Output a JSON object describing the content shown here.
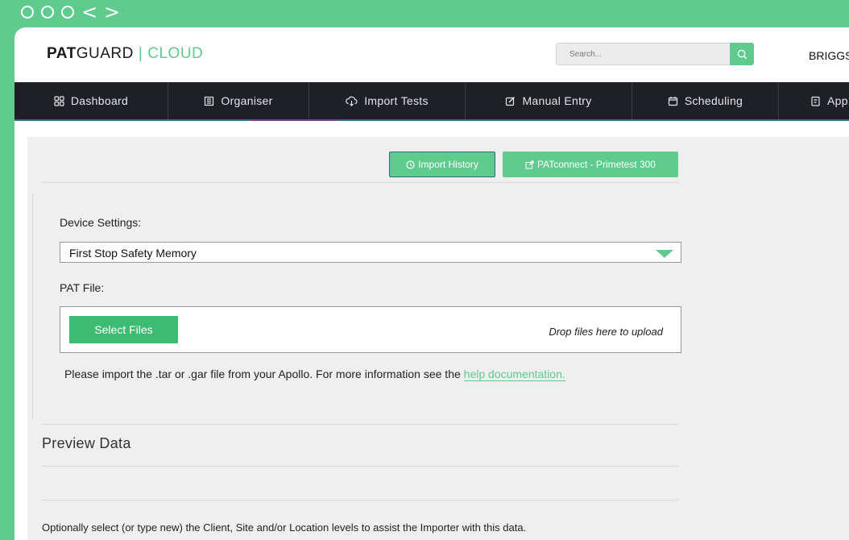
{
  "browser": {
    "back_arrow": "<",
    "forward_arrow": ">"
  },
  "header": {
    "logo_bold": "PAT",
    "logo_regular": "GUARD",
    "logo_separator": "|",
    "logo_cloud": "CLOUD",
    "search_placeholder": "Search...",
    "user_name": "BRIGGS"
  },
  "nav": {
    "items": [
      {
        "label": "Dashboard",
        "icon": "grid-icon"
      },
      {
        "label": "Organiser",
        "icon": "building-icon"
      },
      {
        "label": "Import Tests",
        "icon": "cloud-download-icon"
      },
      {
        "label": "Manual Entry",
        "icon": "edit-icon"
      },
      {
        "label": "Scheduling",
        "icon": "calendar-icon"
      },
      {
        "label": "App",
        "icon": "clipboard-icon"
      }
    ]
  },
  "toolbar": {
    "import_history_label": "Import History",
    "patconnect_label": "PATconnect - Primetest 300"
  },
  "form": {
    "device_settings_label": "Device Settings:",
    "device_selected": "First Stop Safety Memory",
    "pat_file_label": "PAT File:",
    "select_files_label": "Select Files",
    "drop_text": "Drop files here to upload",
    "help_text": "Please import the .tar or .gar file from your Apollo. For more information see the ",
    "help_link": "help documentation."
  },
  "preview": {
    "title": "Preview Data",
    "optional_text": "Optionally select (or type new) the Client, Site and/or Location levels to assist the Importer with this data."
  },
  "colors": {
    "accent": "#5fcb8e",
    "nav_bg": "#1d2029",
    "content_bg": "#efefef"
  }
}
